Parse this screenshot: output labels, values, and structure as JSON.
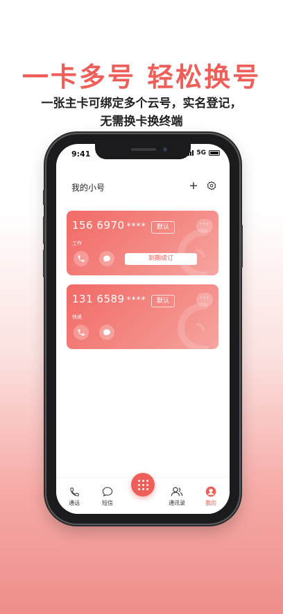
{
  "promo": {
    "headline": "一卡多号  轻松换号",
    "subline1": "一张主卡可绑定多个云号，实名登记，",
    "subline2": "无需换卡换终端"
  },
  "status_bar": {
    "time": "9:41",
    "network": "5G"
  },
  "header": {
    "title": "我的小号"
  },
  "cards": [
    {
      "number": "156 6970",
      "masked": "****",
      "badge": "默认",
      "tag": "工作",
      "renew_label": "到期续订",
      "more": "···"
    },
    {
      "number": "131 6589",
      "masked": "****",
      "badge": "默认",
      "tag": "快递",
      "more": "···"
    }
  ],
  "tabs": [
    {
      "label": "通话",
      "icon": "phone-icon"
    },
    {
      "label": "短信",
      "icon": "message-icon"
    },
    {
      "label": "通讯录",
      "icon": "contacts-icon"
    },
    {
      "label": "我的",
      "icon": "profile-icon",
      "active": true
    }
  ],
  "colors": {
    "accent": "#ee5f5a",
    "card_start": "#f26a66",
    "card_end": "#f7a5a0"
  }
}
